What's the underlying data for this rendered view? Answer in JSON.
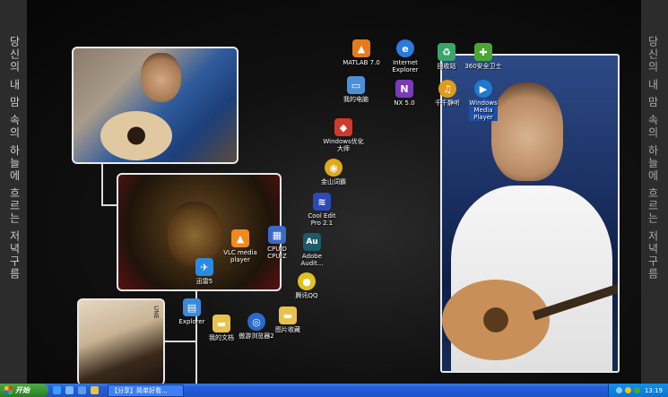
{
  "wallpaper": {
    "left_text": "당신의 내 맘 속의 하늘에 흐르는 저녁구름",
    "right_text": "당신의 내 맘 속의 하늘에 흐르는 저녁구름",
    "photo_caption": "UNE"
  },
  "desktop_icons": [
    {
      "id": "matlab",
      "label": "MATLAB 7.0",
      "glyph": "▲",
      "color": "#e87a1c"
    },
    {
      "id": "ie",
      "label": "Internet\nExplorer",
      "glyph": "e",
      "color": "#2a7ae0"
    },
    {
      "id": "recycle",
      "label": "回收站",
      "glyph": "♻",
      "color": "#3aa56a"
    },
    {
      "id": "360",
      "label": "360安全卫士",
      "glyph": "✚",
      "color": "#4aa832"
    },
    {
      "id": "mycomputer",
      "label": "我的电脑",
      "glyph": "▭",
      "color": "#4a90d9"
    },
    {
      "id": "nx",
      "label": "NX 5.0",
      "glyph": "N",
      "color": "#7a3ab8"
    },
    {
      "id": "qianqian",
      "label": "千千静听",
      "glyph": "♫",
      "color": "#e09b1c"
    },
    {
      "id": "wmp",
      "label": "Windows\nMedia\nPlayer",
      "glyph": "▶",
      "color": "#1c7ad0"
    },
    {
      "id": "winopt",
      "label": "Windows优化\n大师",
      "glyph": "◆",
      "color": "#d03a2a"
    },
    {
      "id": "jinshan",
      "label": "金山词霸",
      "glyph": "◉",
      "color": "#e0a81c"
    },
    {
      "id": "cooledit",
      "label": "Cool Edit\nPro 2.1",
      "glyph": "≋",
      "color": "#2a4ab8"
    },
    {
      "id": "audition",
      "label": "Adobe\nAudit...",
      "glyph": "Au",
      "color": "#1c5a6a"
    },
    {
      "id": "vlc",
      "label": "VLC media\nplayer",
      "glyph": "▲",
      "color": "#f08a1c"
    },
    {
      "id": "cpuz",
      "label": "CPUID\nCPU-Z",
      "glyph": "▦",
      "color": "#3a6ac8"
    },
    {
      "id": "xunlei",
      "label": "迅雷5",
      "glyph": "✈",
      "color": "#2a8ae0"
    },
    {
      "id": "qq",
      "label": "腾讯QQ",
      "glyph": "●",
      "color": "#e0c21c"
    },
    {
      "id": "explorer",
      "label": "Explorer",
      "glyph": "▤",
      "color": "#3a8ad8"
    },
    {
      "id": "mydocs",
      "label": "我的文档",
      "glyph": "▬",
      "color": "#e8c24a"
    },
    {
      "id": "aoyou",
      "label": "傲游浏览器2",
      "glyph": "◎",
      "color": "#2a6ac8"
    },
    {
      "id": "imgcollect",
      "label": "图片收藏",
      "glyph": "▬",
      "color": "#e8c24a"
    }
  ],
  "taskbar": {
    "start_label": "开始",
    "task_label": "【分享】简单好看...",
    "clock": "13:19"
  }
}
